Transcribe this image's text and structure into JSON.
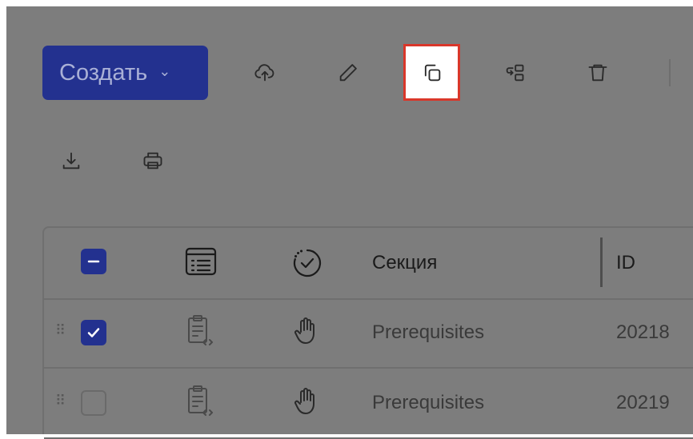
{
  "toolbar": {
    "create_label": "Создать",
    "icons": [
      "upload-cloud-icon",
      "pencil-icon",
      "copy-icon",
      "move-to-icon",
      "trash-icon",
      "download-icon",
      "print-icon"
    ],
    "highlight_color": "#d9372a",
    "accent_color": "#23318f"
  },
  "table": {
    "columns": [
      "Секция",
      "ID"
    ],
    "rows": [
      {
        "section": "Prerequisites",
        "id": "20218",
        "checked": true
      },
      {
        "section": "Prerequisites",
        "id": "20219",
        "checked": false
      }
    ]
  }
}
